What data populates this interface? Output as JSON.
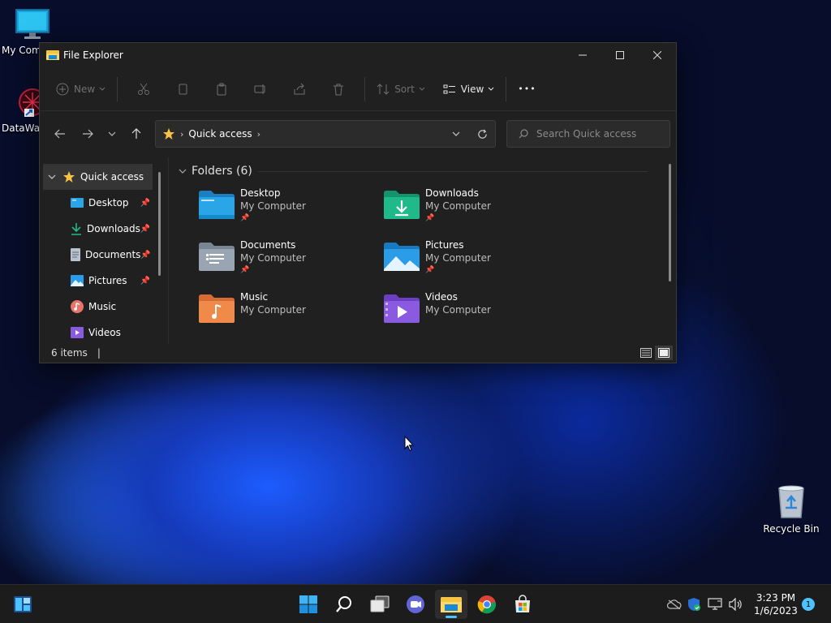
{
  "desktop": {
    "icons": [
      {
        "label": "My Com",
        "icon": "monitor-icon"
      },
      {
        "label": "DataWag",
        "icon": "datawag-app-icon"
      },
      {
        "label": "Recycle Bin",
        "icon": "recycle-bin-icon"
      }
    ]
  },
  "window": {
    "title": "File Explorer",
    "controls": {
      "minimize": "—",
      "maximize": "☐",
      "close": "✕"
    }
  },
  "toolbar": {
    "new_label": "New",
    "sort_label": "Sort",
    "view_label": "View",
    "more_label": "•••"
  },
  "address": {
    "crumb": "Quick access",
    "search_placeholder": "Search Quick access"
  },
  "sidebar": {
    "quick_access": "Quick access",
    "items": [
      {
        "label": "Desktop",
        "pinned": true
      },
      {
        "label": "Downloads",
        "pinned": true
      },
      {
        "label": "Documents",
        "pinned": true
      },
      {
        "label": "Pictures",
        "pinned": true
      },
      {
        "label": "Music",
        "pinned": false
      },
      {
        "label": "Videos",
        "pinned": false
      }
    ]
  },
  "main": {
    "group_header": "Folders (6)",
    "folders": [
      {
        "name": "Desktop",
        "location": "My Computer",
        "pinned": true,
        "color": "#2aa6e8"
      },
      {
        "name": "Downloads",
        "location": "My Computer",
        "pinned": true,
        "color": "#1fb98a"
      },
      {
        "name": "Documents",
        "location": "My Computer",
        "pinned": true,
        "color": "#9aa5b4"
      },
      {
        "name": "Pictures",
        "location": "My Computer",
        "pinned": true,
        "color": "#2b9de8"
      },
      {
        "name": "Music",
        "location": "My Computer",
        "pinned": false,
        "color": "#f08a4b"
      },
      {
        "name": "Videos",
        "location": "My Computer",
        "pinned": false,
        "color": "#8a5ae0"
      }
    ],
    "pin_glyph": "📌"
  },
  "statusbar": {
    "count": "6 items",
    "caret": "|"
  },
  "taskbar": {
    "time": "3:23 PM",
    "date": "1/6/2023",
    "notifications": "1"
  },
  "colors": {
    "accent": "#4cc2ff",
    "window_bg": "#202020",
    "folder_yellow": "#f6c343"
  }
}
